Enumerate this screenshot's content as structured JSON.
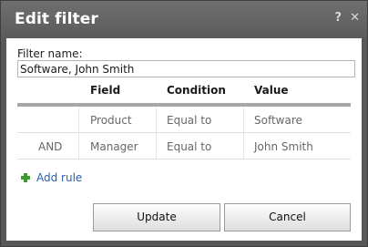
{
  "dialog": {
    "title": "Edit filter",
    "help_icon_text": "?",
    "close_icon_text": "✕"
  },
  "filter": {
    "label": "Filter name:",
    "value": "Software, John Smith"
  },
  "table": {
    "headers": {
      "op": "",
      "field": "Field",
      "condition": "Condition",
      "value": "Value"
    },
    "rows": [
      {
        "op": "",
        "field": "Product",
        "condition": "Equal to",
        "value": "Software"
      },
      {
        "op": "AND",
        "field": "Manager",
        "condition": "Equal to",
        "value": "John Smith"
      }
    ]
  },
  "add_rule": {
    "label": "Add rule",
    "icon": "plus-icon"
  },
  "buttons": {
    "update": "Update",
    "cancel": "Cancel"
  }
}
